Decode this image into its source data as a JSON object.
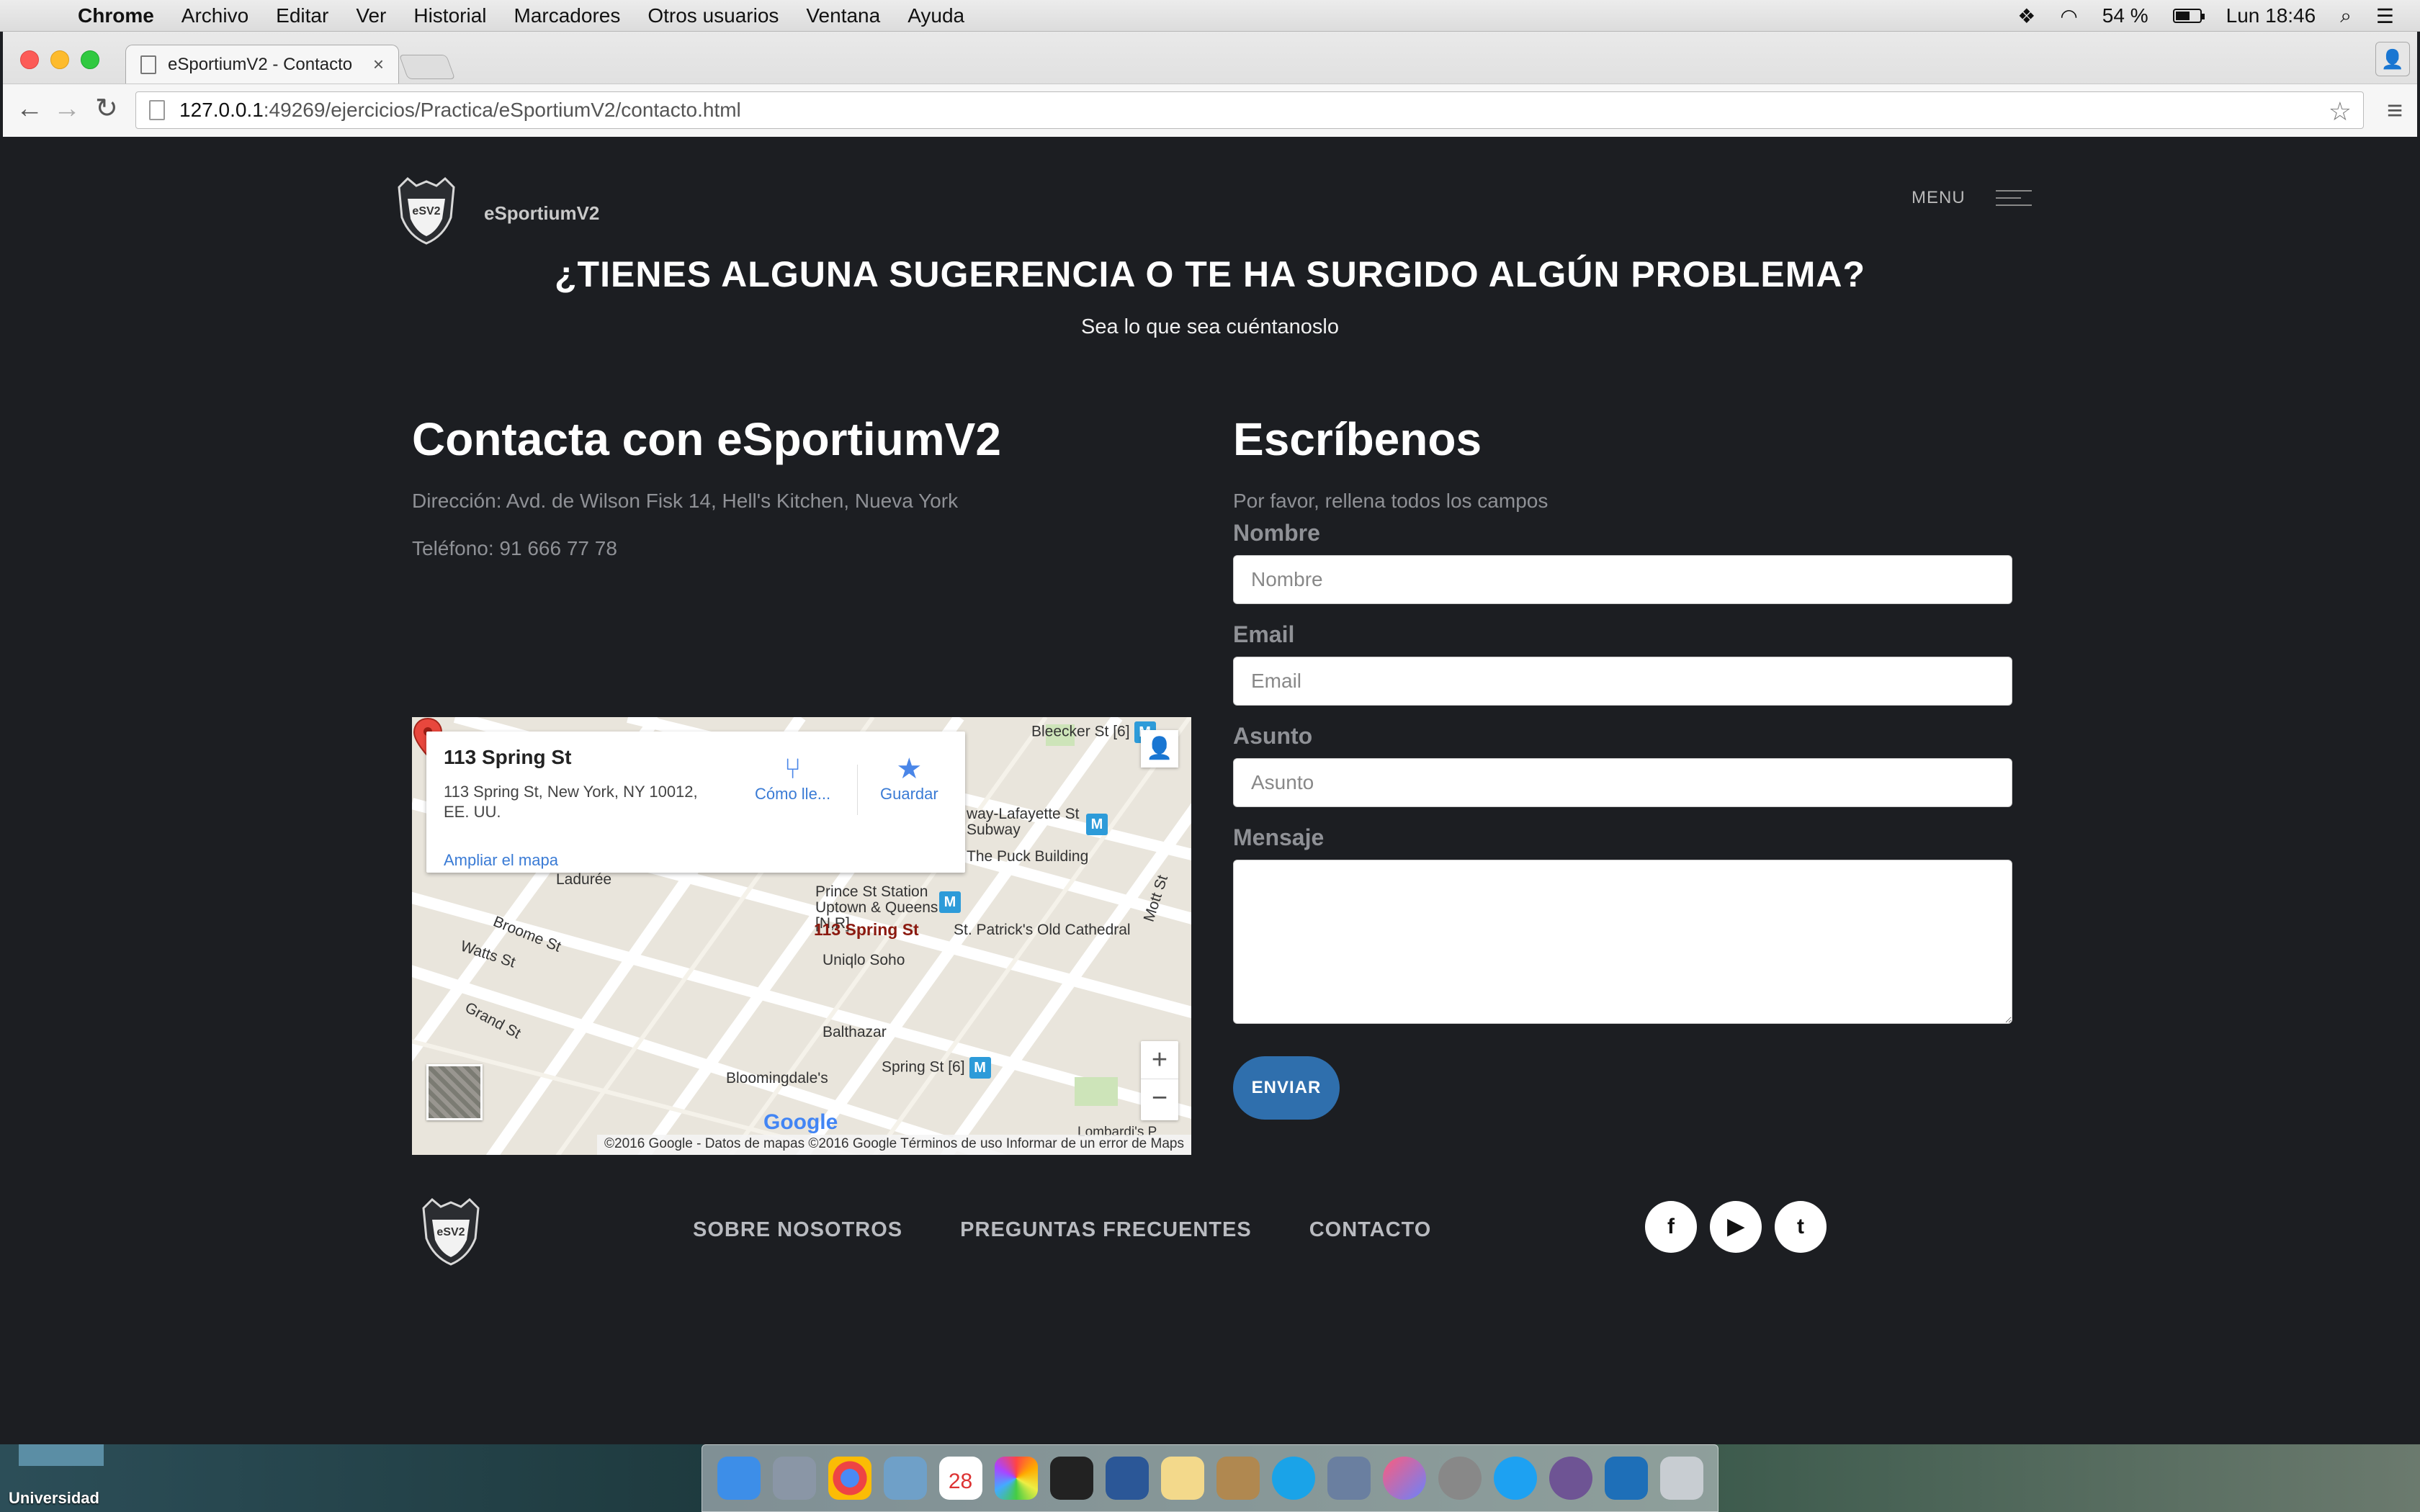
{
  "menubar": {
    "app": "Chrome",
    "items": [
      "Archivo",
      "Editar",
      "Ver",
      "Historial",
      "Marcadores",
      "Otros usuarios",
      "Ventana",
      "Ayuda"
    ],
    "battery": "54 %",
    "clock": "Lun 18:46"
  },
  "browser": {
    "tab_title": "eSportiumV2 - Contacto",
    "url_host": "127.0.0.1",
    "url_path": ":49269/ejercicios/Practica/eSportiumV2/contacto.html"
  },
  "site": {
    "brand": "eSportiumV2",
    "logo_text": "eSV2",
    "menu_label": "MENU",
    "hero_title": "¿TIENES ALGUNA SUGERENCIA O TE HA SURGIDO ALGÚN PROBLEMA?",
    "hero_subtitle": "Sea lo que sea cuéntanoslo"
  },
  "contact": {
    "heading": "Contacta con eSportiumV2",
    "address": "Dirección: Avd. de Wilson Fisk 14, Hell's Kitchen, Nueva York",
    "phone": "Teléfono: 91 666 77 78"
  },
  "map": {
    "info_title": "113 Spring St",
    "info_address": "113 Spring St, New York, NY 10012, EE. UU.",
    "directions_label": "Cómo lle...",
    "save_label": "Guardar",
    "enlarge_link": "Ampliar el mapa",
    "labels": {
      "bleecker": "Bleecker St [6]",
      "broadway": "way-Lafayette St Subway",
      "puck": "The Puck Building",
      "prince": "Prince St Station Uptown & Queens [N,R]",
      "laduree": "Ladurée",
      "spring_pin": "113 Spring St",
      "cathedral": "St. Patrick's Old Cathedral",
      "broome": "Broome St",
      "watts": "Watts St",
      "uniqlo": "Uniqlo Soho",
      "grand": "Grand St",
      "balthazar": "Balthazar",
      "bloomingdales": "Bloomingdale's",
      "spring6": "Spring St [6]",
      "mott": "Mott St",
      "lombardi": "Lombardi's P"
    },
    "metro_letter": "M",
    "google": "Google",
    "attribution": "©2016 Google - Datos de mapas ©2016 Google     Términos de uso     Informar de un error de Maps",
    "zoom_in": "+",
    "zoom_out": "−"
  },
  "form": {
    "heading": "Escríbenos",
    "intro": "Por favor, rellena todos los campos",
    "name_label": "Nombre",
    "name_placeholder": "Nombre",
    "email_label": "Email",
    "email_placeholder": "Email",
    "subject_label": "Asunto",
    "subject_placeholder": "Asunto",
    "message_label": "Mensaje",
    "submit": "ENVIAR"
  },
  "footer": {
    "links": [
      "SOBRE NOSOTROS",
      "PREGUNTAS FRECUENTES",
      "CONTACTO"
    ],
    "social": [
      "f",
      "▶",
      "t"
    ]
  },
  "desktop": {
    "folder_label": "Universidad",
    "calendar_day": "28"
  }
}
